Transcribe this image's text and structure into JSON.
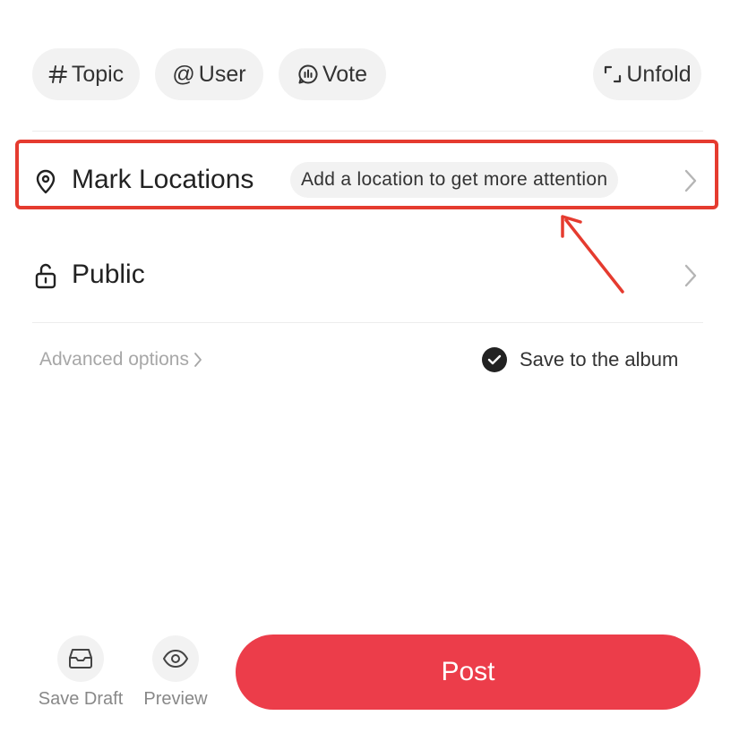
{
  "toolbar": {
    "chips": [
      {
        "label": "Topic",
        "icon": "hash-icon"
      },
      {
        "label": "User",
        "icon": "at-icon"
      },
      {
        "label": "Vote",
        "icon": "vote-icon"
      }
    ],
    "unfold": {
      "label": "Unfold",
      "icon": "unfold-icon"
    }
  },
  "location": {
    "title": "Mark Locations",
    "hint": "Add a location to get more attention",
    "icon": "location-pin-icon"
  },
  "visibility": {
    "title": "Public",
    "icon": "unlock-icon"
  },
  "options": {
    "advanced_label": "Advanced options",
    "save_album_label": "Save to the album",
    "save_album_checked": true
  },
  "bottom": {
    "save_draft_label": "Save Draft",
    "preview_label": "Preview",
    "post_label": "Post",
    "post_color": "#ec3d4a"
  },
  "annotation": {
    "highlight_color": "#e53b2f"
  }
}
